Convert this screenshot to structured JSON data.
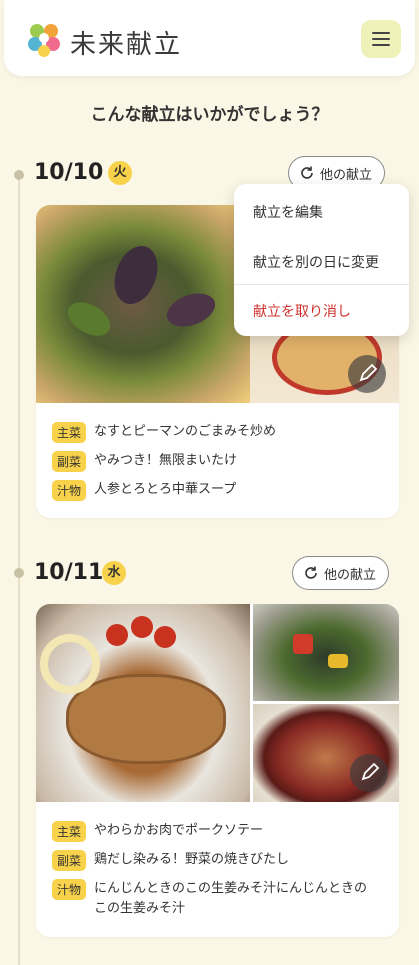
{
  "header": {
    "brand": "未来献立"
  },
  "headline": "こんな献立はいかがでしょう？",
  "days": [
    {
      "date": "10/10",
      "weekday": "火",
      "other_label": "他の献立",
      "dishes": [
        {
          "tag": "主菜",
          "name": "なすとピーマンのごまみそ炒め"
        },
        {
          "tag": "副菜",
          "name": "やみつき！無限まいたけ"
        },
        {
          "tag": "汁物",
          "name": "人参とろとろ中華スープ"
        }
      ]
    },
    {
      "date": "10/11",
      "weekday": "水",
      "other_label": "他の献立",
      "dishes": [
        {
          "tag": "主菜",
          "name": "やわらかお肉でポークソテー"
        },
        {
          "tag": "副菜",
          "name": "鶏だし染みる！野菜の焼きびたし"
        },
        {
          "tag": "汁物",
          "name": "にんじんときのこの生姜みそ汁にんじんときのこの生姜みそ汁"
        }
      ]
    }
  ],
  "menu": {
    "edit": "献立を編集",
    "change_day": "献立を別の日に変更",
    "cancel": "献立を取り消し"
  },
  "colors": {
    "background": "#FBF7E6",
    "accent_yellow": "#F7D24A",
    "menu_button": "#EEF2B8",
    "danger": "#D0312D"
  }
}
